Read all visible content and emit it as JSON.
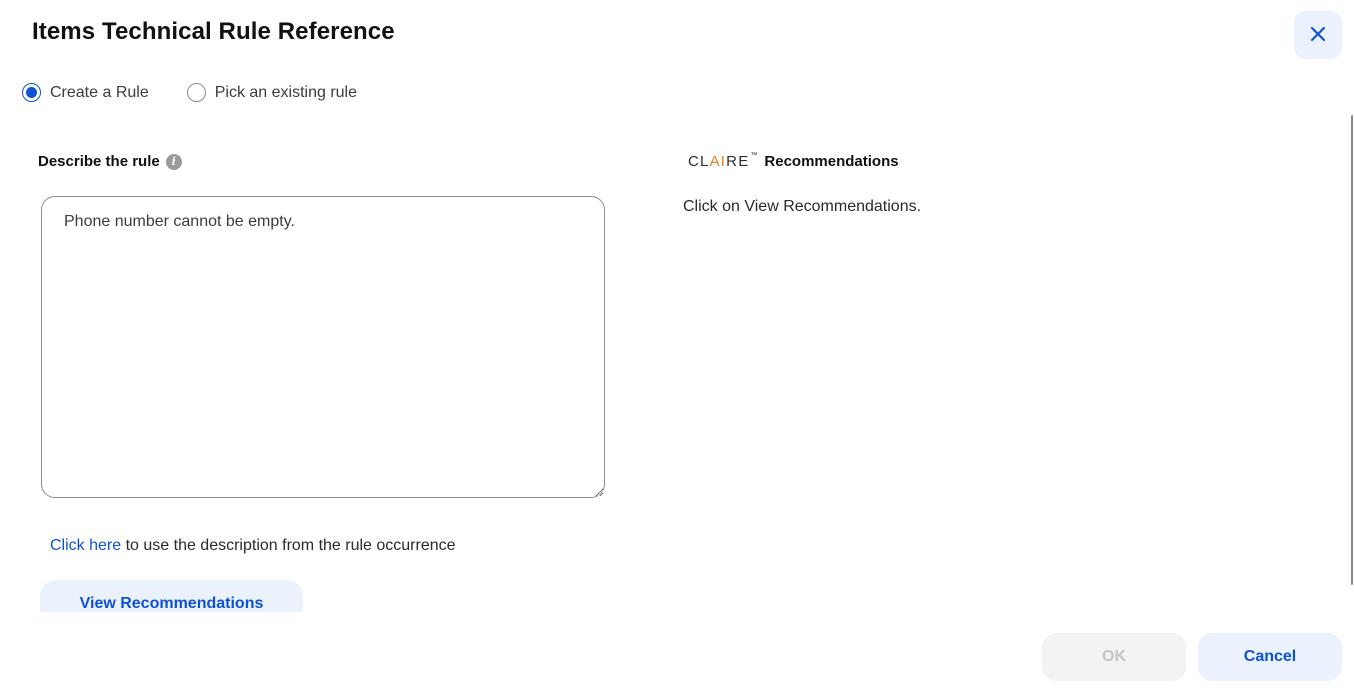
{
  "dialog": {
    "title": "Items Technical Rule Reference",
    "close_icon": "close-icon"
  },
  "mode_options": [
    {
      "label": "Create a Rule",
      "selected": true
    },
    {
      "label": "Pick an existing rule",
      "selected": false
    }
  ],
  "describe": {
    "label": "Describe the rule",
    "info_icon": "info-icon",
    "info_glyph": "i",
    "value": "Phone number cannot be empty.",
    "click_here_link": "Click here",
    "click_here_suffix": " to use the description from the rule occurrence",
    "view_button": "View Recommendations"
  },
  "recommendations": {
    "brand_pre": "CL",
    "brand_accent": "AI",
    "brand_post": "RE",
    "brand_tm": "™",
    "title": "Recommendations",
    "hint": "Click on View Recommendations."
  },
  "footer": {
    "ok_label": "OK",
    "ok_disabled": true,
    "cancel_label": "Cancel"
  },
  "colors": {
    "accent": "#0c52d6",
    "accent_bg": "#ebf2fd",
    "claire_orange": "#f07b18",
    "disabled_bg": "#f3f3f3",
    "disabled_text": "#c4c4c4"
  }
}
